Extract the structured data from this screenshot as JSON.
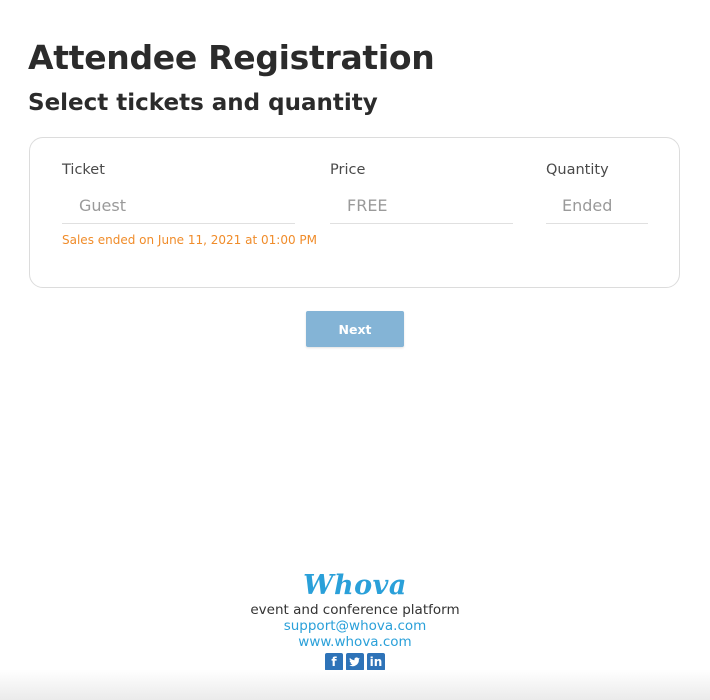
{
  "header": {
    "title": "Attendee Registration",
    "subtitle": "Select tickets and quantity"
  },
  "tickets": {
    "columns": {
      "ticket": "Ticket",
      "price": "Price",
      "quantity": "Quantity"
    },
    "rows": [
      {
        "name": "Guest",
        "price": "FREE",
        "quantity": "Ended",
        "note": "Sales ended on June 11, 2021 at 01:00 PM"
      }
    ]
  },
  "actions": {
    "next_label": "Next"
  },
  "footer": {
    "logo": "Whova",
    "tagline": "event and conference platform",
    "email": "support@whova.com",
    "website": "www.whova.com",
    "social_icons": [
      "facebook-icon",
      "twitter-icon",
      "linkedin-icon"
    ]
  },
  "colors": {
    "accent": "#2aa0d9",
    "warning": "#f08c2a",
    "button": "#84b4d6",
    "social": "#2e73b8"
  }
}
